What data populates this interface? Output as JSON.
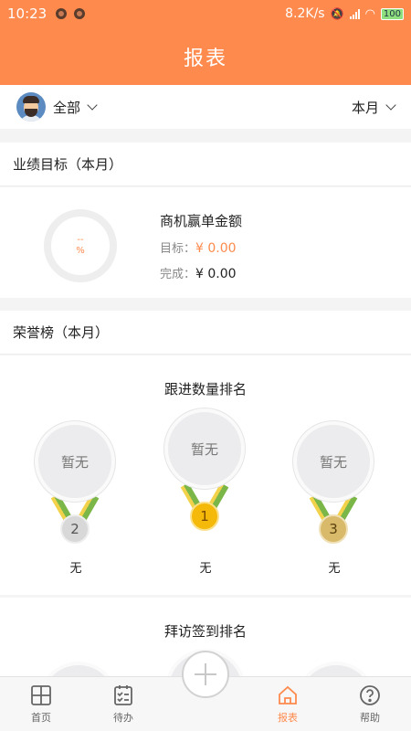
{
  "status_bar": {
    "time": "10:23",
    "speed": "8.2K/s",
    "battery": "100"
  },
  "header": {
    "title": "报表"
  },
  "filter": {
    "scope_label": "全部",
    "period_label": "本月"
  },
  "goal_section": {
    "title": "业绩目标（本月）",
    "ring_dash": "--",
    "ring_percent": "%",
    "kpi_name": "商机赢单金额",
    "target_label": "目标：",
    "target_value": "¥ 0.00",
    "done_label": "完成：",
    "done_value": "¥ 0.00"
  },
  "honor_section": {
    "title": "荣誉榜（本月）",
    "follow_rank": {
      "title": "跟进数量排名",
      "entries": [
        {
          "rank": "2",
          "avatar_text": "暂无",
          "name": "无"
        },
        {
          "rank": "1",
          "avatar_text": "暂无",
          "name": "无"
        },
        {
          "rank": "3",
          "avatar_text": "暂无",
          "name": "无"
        }
      ]
    },
    "visit_rank": {
      "title": "拜访签到排名"
    }
  },
  "colors": {
    "accent": "#fe8a4d",
    "gold": "#f5b90a",
    "silver": "#d8d8d8",
    "bronze": "#d9b96a"
  },
  "nav": {
    "items": [
      {
        "label": "首页",
        "icon": "home-grid-icon"
      },
      {
        "label": "待办",
        "icon": "checklist-icon"
      },
      {
        "label": "报表",
        "icon": "house-icon",
        "active": true
      },
      {
        "label": "帮助",
        "icon": "help-icon"
      }
    ],
    "center_icon": "plus-icon"
  }
}
